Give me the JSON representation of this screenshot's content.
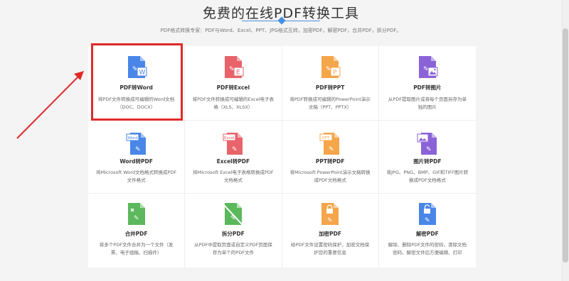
{
  "header": {
    "title": "免费的在线PDF转换工具",
    "subtitle": "PDF格式转换专家：PDF与Word、Excel、PPT、JPG格式互转，加密PDF，解密PDF，合并PDF，拆分PDF。"
  },
  "tools": [
    {
      "title": "PDF转Word",
      "desc": "将PDF文件转换成可编辑的Word文档（DOC、DOCX）",
      "icon": "pdf-to-word-icon",
      "color": "#4a86e8",
      "badge": "W"
    },
    {
      "title": "PDF转Excel",
      "desc": "将PDF文件转换成可编辑的Excel电子表格（XLS、XLSX）",
      "icon": "pdf-to-excel-icon",
      "color": "#e8636a",
      "badge": "E"
    },
    {
      "title": "PDF转PPT",
      "desc": "将PDF转换成可编辑的PowerPoint演示文稿（PPT、PPTX）",
      "icon": "pdf-to-ppt-icon",
      "color": "#f5a54a",
      "badge": "P"
    },
    {
      "title": "PDF转图片",
      "desc": "从PDF提取图片或将每个页面另存为单独的图片",
      "icon": "pdf-to-image-icon",
      "color": "#8b63d8",
      "badge": "img"
    },
    {
      "title": "Word转PDF",
      "desc": "将Microsoft Word文档格式转换成PDF文件格式",
      "icon": "word-to-pdf-icon",
      "color": "#4a86e8",
      "badge": "Word"
    },
    {
      "title": "Excel转PDF",
      "desc": "将Microsoft Excel电子表格转换成PDF文档格式",
      "icon": "excel-to-pdf-icon",
      "color": "#e8636a",
      "badge": "Excel"
    },
    {
      "title": "PPT转PDF",
      "desc": "将Microsoft PowerPoint演示文稿转换成PDF文档格式",
      "icon": "ppt-to-pdf-icon",
      "color": "#f5a54a",
      "badge": "PPT"
    },
    {
      "title": "图片转PDF",
      "desc": "将JPG、PNG、BMP、GIF和TIFF图片转换成PDF文档格式",
      "icon": "image-to-pdf-icon",
      "color": "#8b63d8",
      "badge": "img"
    },
    {
      "title": "合并PDF",
      "desc": "将多个PDF文件合并为一个文件（发票、电子组稿、扫描件）",
      "icon": "merge-pdf-icon",
      "color": "#5cb85c",
      "badge": "merge"
    },
    {
      "title": "拆分PDF",
      "desc": "从PDF中提取页面或自定义PDF页面保存为单个的PDF文件",
      "icon": "split-pdf-icon",
      "color": "#5cb85c",
      "badge": "split"
    },
    {
      "title": "加密PDF",
      "desc": "给PDF文件设置密码保护，加密文档保护您的重要信息",
      "icon": "encrypt-pdf-icon",
      "color": "#f5a54a",
      "badge": "lock"
    },
    {
      "title": "解密PDF",
      "desc": "解除、删除PDF文件的密码，清除文档密码、解密文件后方便编辑、打印",
      "icon": "decrypt-pdf-icon",
      "color": "#4a86e8",
      "badge": "unlock"
    }
  ]
}
